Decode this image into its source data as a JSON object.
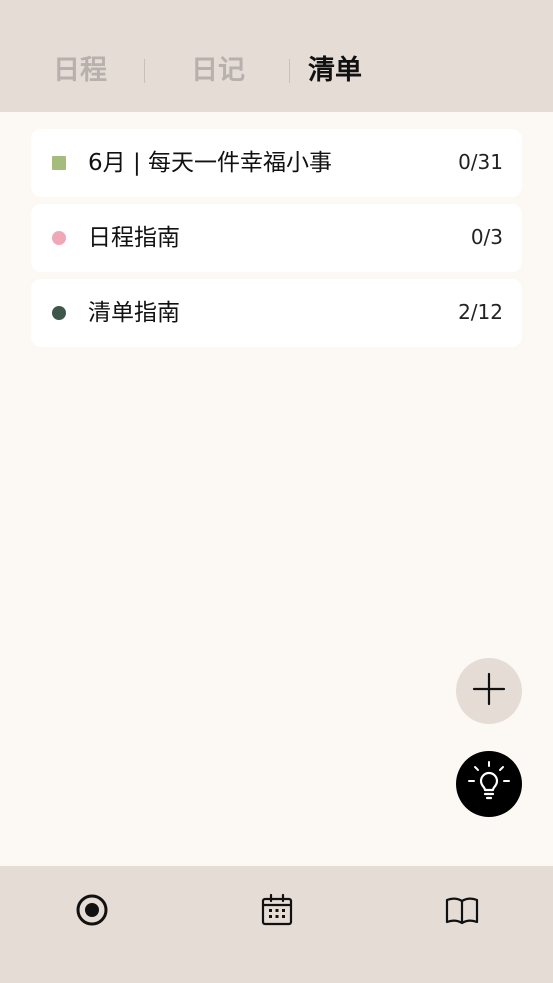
{
  "tabs": [
    {
      "label": "日程",
      "active": false
    },
    {
      "label": "日记",
      "active": false
    },
    {
      "label": "清单",
      "active": true
    }
  ],
  "lists": [
    {
      "title": "6月 | 每天一件幸福小事",
      "count": "0/31",
      "marker": "square",
      "color": "#a4bd7c"
    },
    {
      "title": "日程指南",
      "count": "0/3",
      "marker": "dot",
      "color": "#f0a7b8"
    },
    {
      "title": "清单指南",
      "count": "2/12",
      "marker": "dot",
      "color": "#3d574a"
    }
  ],
  "fab": {
    "add_icon": "plus-icon",
    "idea_icon": "lightbulb-icon"
  },
  "bottom_nav": [
    {
      "icon": "record-icon"
    },
    {
      "icon": "calendar-icon"
    },
    {
      "icon": "book-icon"
    }
  ],
  "colors": {
    "header_bg": "#e6dcd6",
    "page_bg": "#fcf8f3",
    "card_bg": "#ffffff",
    "inactive_tab": "#b8b0ad",
    "active_tab": "#111111"
  }
}
